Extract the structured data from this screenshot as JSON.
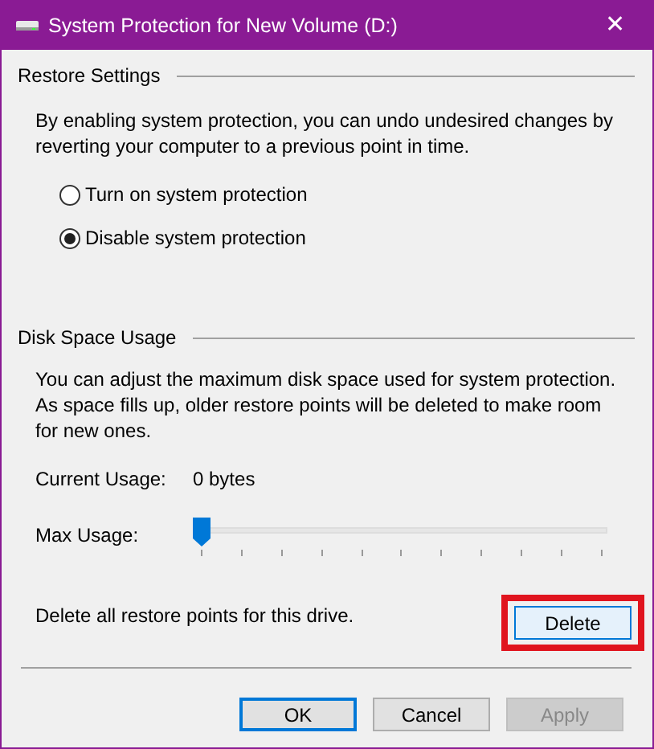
{
  "window": {
    "title": "System Protection for New Volume (D:)",
    "close": "✕"
  },
  "restore_settings": {
    "heading": "Restore Settings",
    "description": "By enabling system protection, you can undo undesired changes by reverting your computer to a previous point in time.",
    "options": [
      {
        "label": "Turn on system protection",
        "selected": false
      },
      {
        "label": "Disable system protection",
        "selected": true
      }
    ]
  },
  "disk_space_usage": {
    "heading": "Disk Space Usage",
    "description": "You can adjust the maximum disk space used for system protection. As space fills up, older restore points will be deleted to make room for new ones.",
    "current_usage_label": "Current Usage:",
    "current_usage_value": "0 bytes",
    "max_usage_label": "Max Usage:",
    "max_usage": {
      "level": 0
    },
    "delete_text": "Delete all restore points for this drive.",
    "delete_button": {
      "label": "Delete",
      "highlighted": true
    }
  },
  "buttons": [
    {
      "label": "OK",
      "kind": "default",
      "disabled": false
    },
    {
      "label": "Cancel",
      "kind": "normal",
      "disabled": false
    },
    {
      "label": "Apply",
      "kind": "normal",
      "disabled": true
    }
  ]
}
